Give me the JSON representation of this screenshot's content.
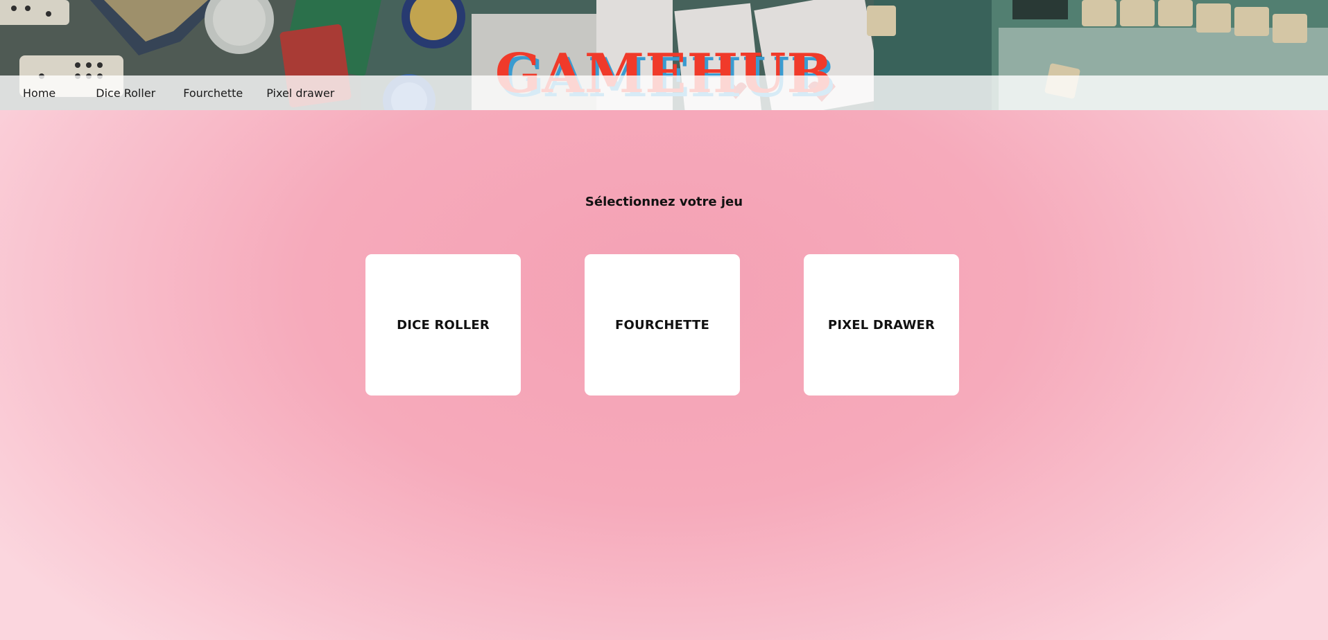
{
  "header": {
    "site_title": "GAMEHUB",
    "title_color": "#f03a2a",
    "title_shadow_color": "#3a9bd0"
  },
  "nav": {
    "items": [
      {
        "label": "Home"
      },
      {
        "label": "Dice Roller"
      },
      {
        "label": "Fourchette"
      },
      {
        "label": "Pixel drawer"
      }
    ]
  },
  "main": {
    "heading": "Sélectionnez votre jeu",
    "cards": [
      {
        "label": "DICE ROLLER"
      },
      {
        "label": "FOURCHETTE"
      },
      {
        "label": "PIXEL DRAWER"
      }
    ]
  },
  "colors": {
    "background_center": "#f4a1b4",
    "background_edge": "#fbd6de",
    "card_background": "#ffffff"
  }
}
